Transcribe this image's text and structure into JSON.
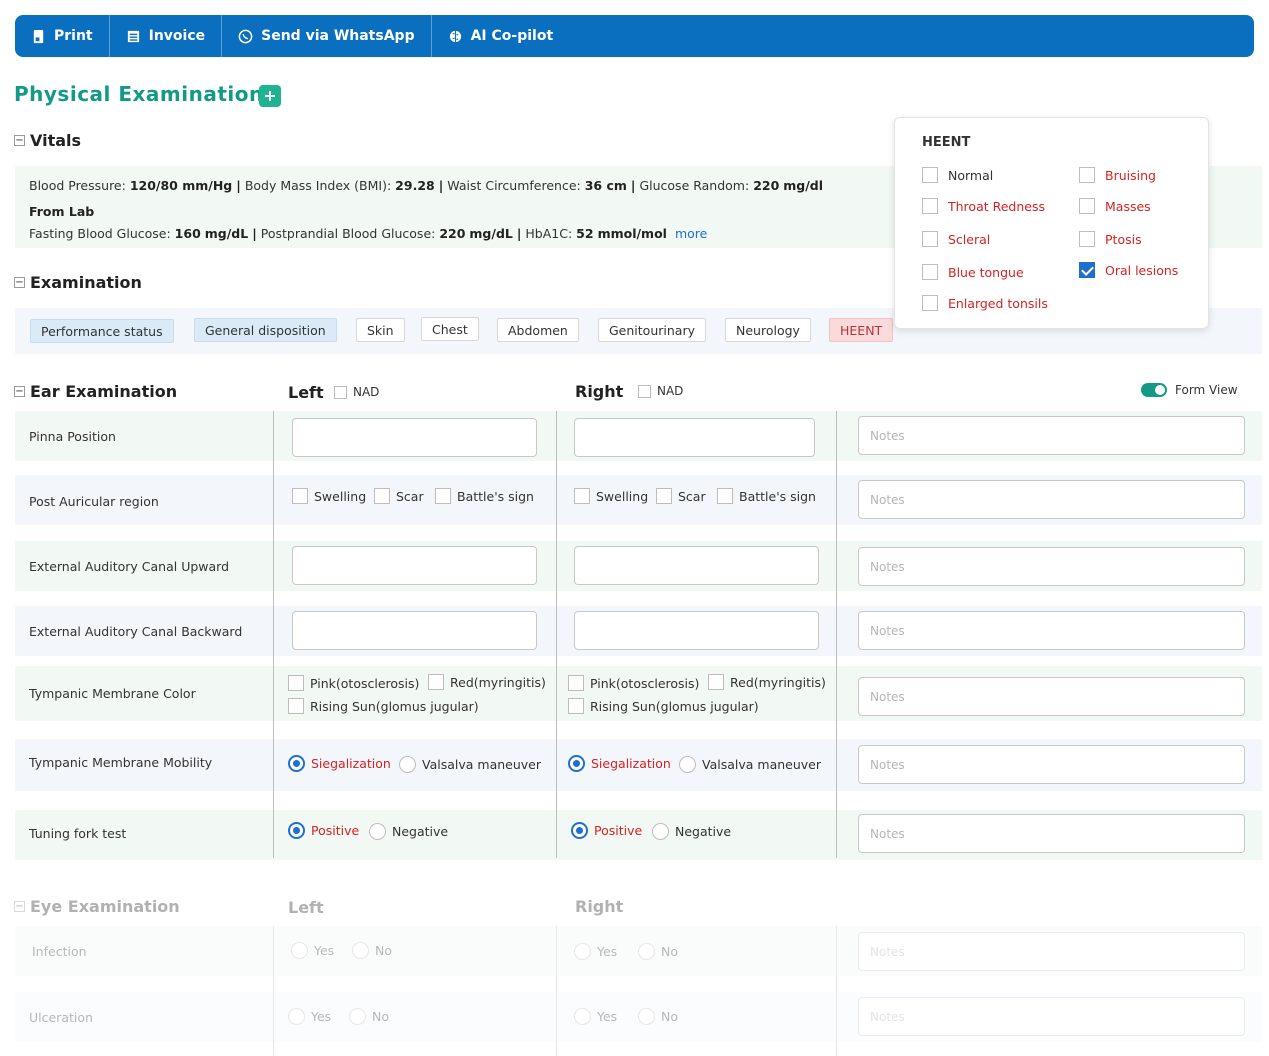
{
  "toolbar": {
    "print": "Print",
    "invoice": "Invoice",
    "whatsapp": "Send via WhatsApp",
    "copilot": "AI Co-pilot",
    "color": "#0a6fbf"
  },
  "title": "Physical Examination",
  "vitals": {
    "heading": "Vitals",
    "bp_label": "Blood Pressure:",
    "bp_value": "120/80 mm/Hg",
    "bmi_label": "Body Mass Index (BMI):",
    "bmi_value": "29.28",
    "waist_label": "Waist Circumference:",
    "waist_value": "36 cm",
    "glucose_label": "Glucose Random:",
    "glucose_value": "220",
    "glucose_unit": "mg/dl",
    "from_lab": "From Lab",
    "fbg_label": "Fasting Blood Glucose:",
    "fbg_value": "160",
    "fbg_unit": "mg/dL",
    "ppbg_label": "Postprandial Blood Glucose:",
    "ppbg_value": "220",
    "ppbg_unit": "mg/dL",
    "hba1c_label": "HbA1C:",
    "hba1c_value": "52",
    "hba1c_unit": "mmol/mol",
    "more": "more",
    "sep": "|"
  },
  "examination": {
    "heading": "Examination",
    "chips": [
      "Performance status",
      "General disposition",
      "Skin",
      "Chest",
      "Abdomen",
      "Genitourinary",
      "Neurology",
      "HEENT"
    ]
  },
  "heent": {
    "heading": "HEENT",
    "left_items": [
      {
        "label": "Normal",
        "checked": false
      },
      {
        "label": "Throat Redness",
        "checked": false
      },
      {
        "label": "Scleral",
        "checked": false
      },
      {
        "label": "Blue tongue",
        "checked": false
      },
      {
        "label": "Enlarged tonsils",
        "checked": false
      }
    ],
    "right_items": [
      {
        "label": "Bruising",
        "checked": false
      },
      {
        "label": "Masses",
        "checked": false
      },
      {
        "label": "Ptosis",
        "checked": false
      },
      {
        "label": "Oral lesions",
        "checked": true
      }
    ]
  },
  "ear": {
    "heading": "Ear Examination",
    "left": "Left",
    "right": "Right",
    "nad": "NAD",
    "form_view": "Form View",
    "notes_placeholder": "Notes",
    "rows": [
      "Pinna Position",
      "Post Auricular region",
      "External Auditory Canal Upward",
      "External Auditory Canal Backward",
      "Tympanic Membrane Color",
      "Tympanic Membrane Mobility",
      "Tuning fork test"
    ],
    "post_auricular_opts": [
      "Swelling",
      "Scar",
      "Battle's sign"
    ],
    "tm_color_opts": [
      "Pink(otosclerosis)",
      "Red(myringitis)",
      "Rising Sun(glomus jugular)"
    ],
    "tm_mobility_opts": [
      "Siegalization",
      "Valsalva maneuver"
    ],
    "tuning_opts": [
      "Positive",
      "Negative"
    ]
  },
  "eye": {
    "heading": "Eye Examination",
    "left": "Left",
    "right": "Right",
    "rows": [
      "Infection",
      "Ulceration"
    ],
    "yes": "Yes",
    "no": "No",
    "notes_placeholder": "Notes"
  }
}
